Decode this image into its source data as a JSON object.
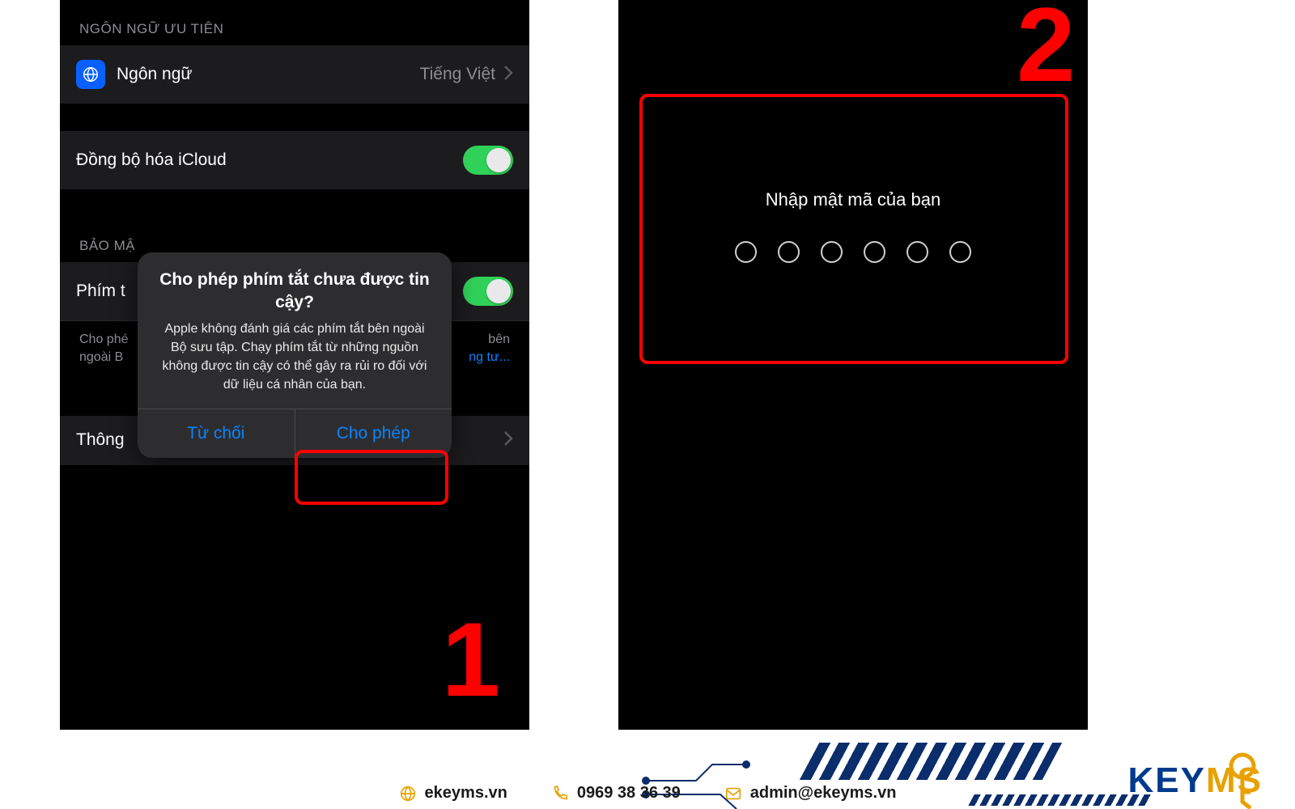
{
  "steps": {
    "one": "1",
    "two": "2"
  },
  "phone1": {
    "section_lang_header": "NGÔN NGỮ ƯU TIÊN",
    "language_row": {
      "label": "Ngôn ngữ",
      "value": "Tiếng Việt",
      "icon": "globe-icon"
    },
    "icloud_row": {
      "label": "Đồng bộ hóa iCloud",
      "state": "on"
    },
    "section_security_header": "BẢO MẬ",
    "shortcut_row": {
      "label_partial": "Phím t",
      "state": "on"
    },
    "footnote_left": "Cho phé",
    "footnote_right": "bên",
    "footnote_line2_left": "ngoài B",
    "footnote_link_tail": "ng tư...",
    "info_row": {
      "label": "Thông"
    },
    "dialog": {
      "title": "Cho phép phím tắt chưa được tin cậy?",
      "message": "Apple không đánh giá các phím tắt bên ngoài Bộ sưu tập. Chạy phím tắt từ những nguồn không được tin cậy có thể gây ra rủi ro đối với dữ liệu cá nhân của bạn.",
      "cancel": "Từ chối",
      "confirm": "Cho phép"
    }
  },
  "phone2": {
    "passcode_title": "Nhập mật mã của bạn",
    "passcode_length": 6
  },
  "branding": {
    "web": "ekeyms.vn",
    "phone": "0969 38 36 39",
    "email": "admin@ekeyms.vn",
    "logo_part1": "KEY",
    "logo_part2": "MS",
    "accent_color": "#e8a100",
    "primary_color": "#003a8c"
  }
}
